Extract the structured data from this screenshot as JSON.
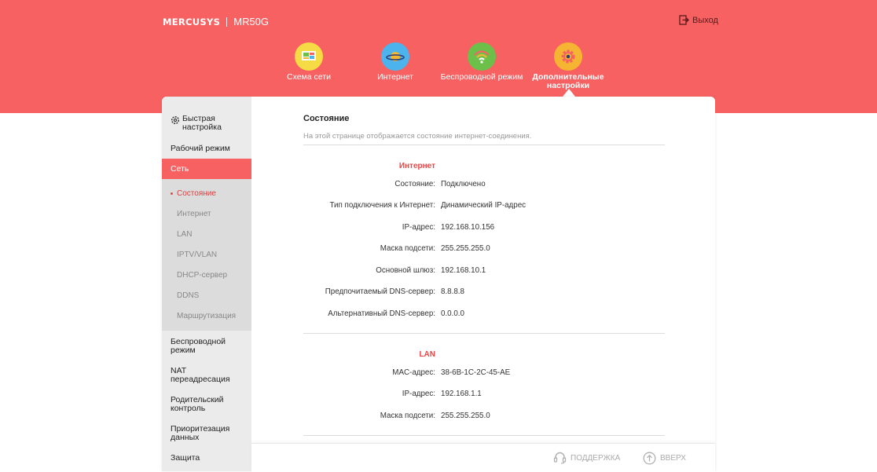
{
  "brand": {
    "logo": "MERCUSYS",
    "model": "MR50G"
  },
  "header": {
    "logout_label": "Выход"
  },
  "nav": [
    {
      "label": "Схема сети",
      "icon": "network-map-icon",
      "color": "#f5dc45"
    },
    {
      "label": "Интернет",
      "icon": "planet-icon",
      "color": "#4cb3ec"
    },
    {
      "label": "Беспроводной режим",
      "icon": "wifi-icon",
      "color": "#6cc04a"
    },
    {
      "label": "Дополнительные настройки",
      "icon": "gear-icon",
      "color": "#f5b431"
    }
  ],
  "sidebar": {
    "items": [
      {
        "label": "Быстрая настройка"
      },
      {
        "label": "Рабочий режим"
      },
      {
        "label": "Сеть"
      },
      {
        "label": "Беспроводной режим"
      },
      {
        "label": "NAT переадресация"
      },
      {
        "label": "Родительский контроль"
      },
      {
        "label": "Приоритезация данных"
      },
      {
        "label": "Защита"
      }
    ],
    "submenu": [
      {
        "label": "Состояние"
      },
      {
        "label": "Интернет"
      },
      {
        "label": "LAN"
      },
      {
        "label": "IPTV/VLAN"
      },
      {
        "label": "DHCP-сервер"
      },
      {
        "label": "DDNS"
      },
      {
        "label": "Маршрутизация"
      }
    ]
  },
  "page": {
    "title": "Состояние",
    "description": "На этой странице отображается состояние интернет-соединения."
  },
  "internet": {
    "title": "Интернет",
    "rows": [
      {
        "label": "Состояние:",
        "value": "Подключено"
      },
      {
        "label": "Тип подключения к Интернет:",
        "value": "Динамический IP-адрес"
      },
      {
        "label": "IP-адрес:",
        "value": "192.168.10.156"
      },
      {
        "label": "Маска подсети:",
        "value": "255.255.255.0"
      },
      {
        "label": "Основной шлюз:",
        "value": "192.168.10.1"
      },
      {
        "label": "Предпочитаемый DNS-сервер:",
        "value": "8.8.8.8"
      },
      {
        "label": "Альтернативный DNS-сервер:",
        "value": "0.0.0.0"
      }
    ]
  },
  "lan": {
    "title": "LAN",
    "rows": [
      {
        "label": "MAC-адрес:",
        "value": "38-6B-1C-2C-45-AE"
      },
      {
        "label": "IP-адрес:",
        "value": "192.168.1.1"
      },
      {
        "label": "Маска подсети:",
        "value": "255.255.255.0"
      }
    ]
  },
  "footer": {
    "support_label": "ПОДДЕРЖКА",
    "top_label": "ВВЕРХ"
  },
  "colors": {
    "accent": "#f86162",
    "section_title": "#e84545"
  }
}
